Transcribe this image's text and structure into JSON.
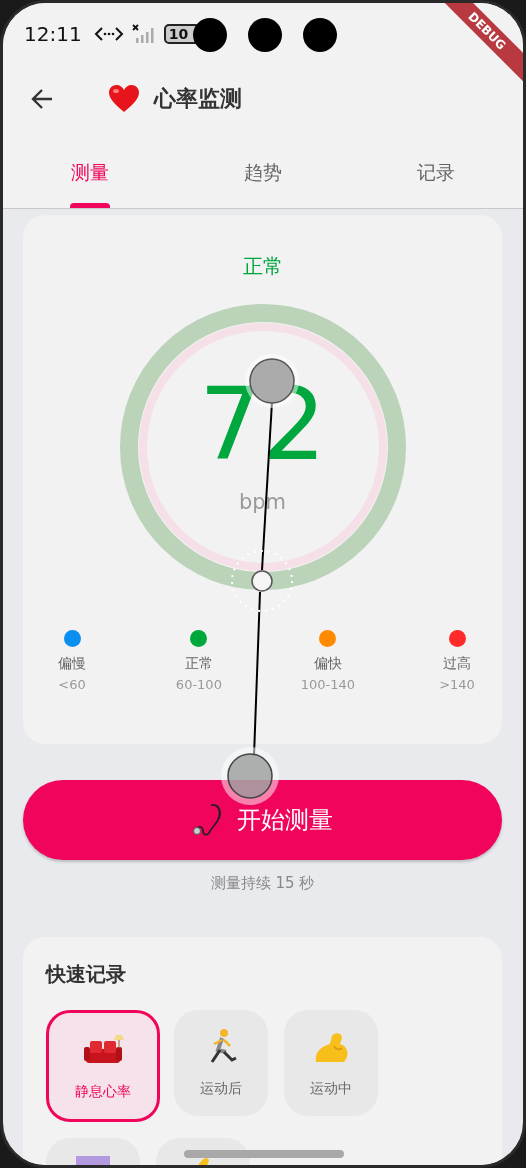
{
  "status_bar": {
    "time": "12:11",
    "battery": "10"
  },
  "debug_banner": "DEBUG",
  "app_bar": {
    "title": "心率监测"
  },
  "tabs": [
    {
      "label": "测量",
      "selected": true
    },
    {
      "label": "趋势",
      "selected": false
    },
    {
      "label": "记录",
      "selected": false
    }
  ],
  "reading": {
    "status": "正常",
    "value": "72",
    "unit": "bpm",
    "level": 1
  },
  "legend": [
    {
      "label": "偏慢",
      "range": "<60",
      "color": "#0a8ef0"
    },
    {
      "label": "正常",
      "range": "60-100",
      "color": "#00a83c"
    },
    {
      "label": "偏快",
      "range": "100-140",
      "color": "#ff8a00"
    },
    {
      "label": "过高",
      "range": ">140",
      "color": "#ff2a2a"
    }
  ],
  "start_button": {
    "label": "开始测量"
  },
  "caption": "测量持续 15 秒",
  "quick_record": {
    "title": "快速记录",
    "items": [
      {
        "label": "静息心率",
        "selected": true
      },
      {
        "label": "运动后",
        "selected": false
      },
      {
        "label": "运动中",
        "selected": false
      },
      {
        "selected": false
      },
      {
        "selected": false
      }
    ]
  }
}
